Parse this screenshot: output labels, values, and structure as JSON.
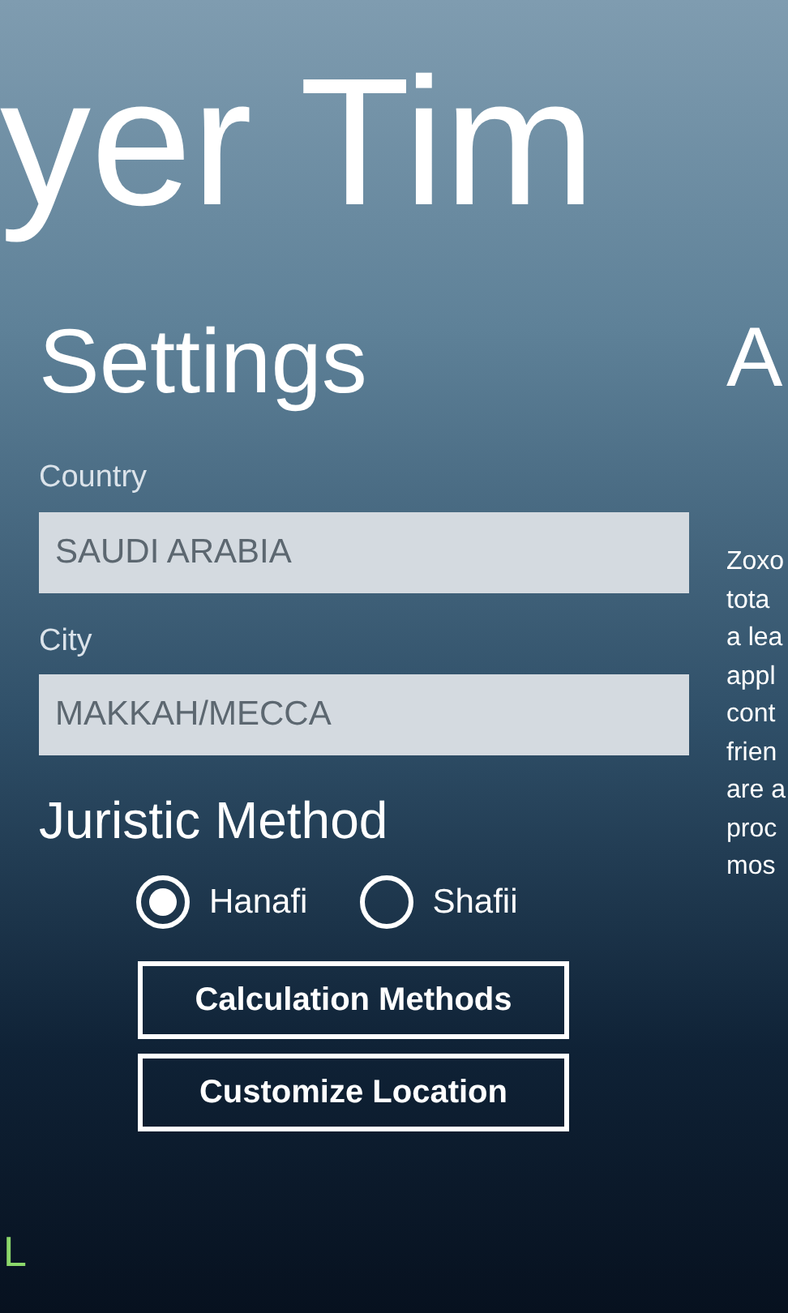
{
  "panorama_title": "yer Tim",
  "settings": {
    "heading": "Settings",
    "fields": [
      {
        "label": "Country",
        "value": "SAUDI ARABIA"
      },
      {
        "label": "City",
        "value": "MAKKAH/MECCA"
      }
    ],
    "juristic_heading": "Juristic Method",
    "options": [
      {
        "label": "Hanafi",
        "selected": true
      },
      {
        "label": "Shafii",
        "selected": false
      }
    ],
    "buttons": [
      "Calculation Methods",
      "Customize Location"
    ]
  },
  "next_section": {
    "heading": "A",
    "lines": [
      "Zoxo",
      "tota",
      "a lea",
      "appl",
      "cont",
      "frien",
      "are a",
      "proc",
      "mos"
    ]
  },
  "corner_letter": "L"
}
